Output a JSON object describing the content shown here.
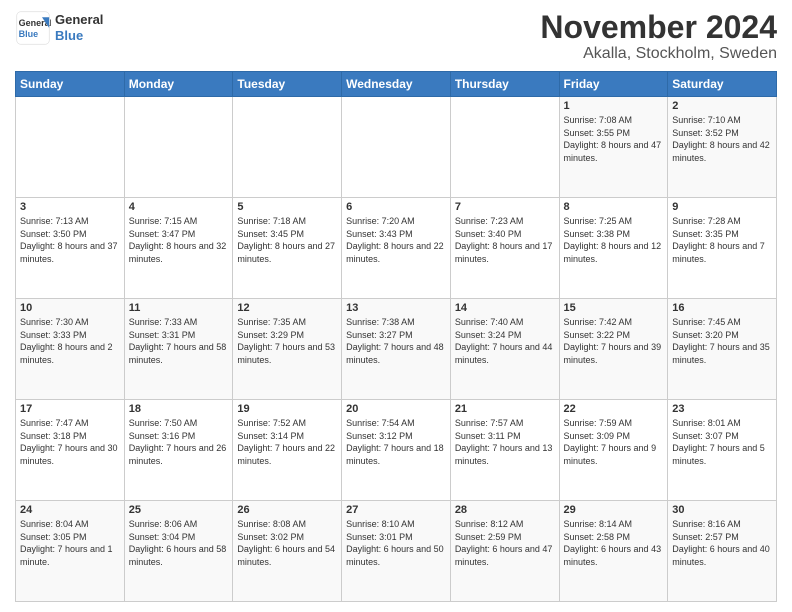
{
  "logo": {
    "line1": "General",
    "line2": "Blue"
  },
  "title": "November 2024",
  "location": "Akalla, Stockholm, Sweden",
  "days_of_week": [
    "Sunday",
    "Monday",
    "Tuesday",
    "Wednesday",
    "Thursday",
    "Friday",
    "Saturday"
  ],
  "weeks": [
    [
      {
        "day": "",
        "info": ""
      },
      {
        "day": "",
        "info": ""
      },
      {
        "day": "",
        "info": ""
      },
      {
        "day": "",
        "info": ""
      },
      {
        "day": "",
        "info": ""
      },
      {
        "day": "1",
        "info": "Sunrise: 7:08 AM\nSunset: 3:55 PM\nDaylight: 8 hours and 47 minutes."
      },
      {
        "day": "2",
        "info": "Sunrise: 7:10 AM\nSunset: 3:52 PM\nDaylight: 8 hours and 42 minutes."
      }
    ],
    [
      {
        "day": "3",
        "info": "Sunrise: 7:13 AM\nSunset: 3:50 PM\nDaylight: 8 hours and 37 minutes."
      },
      {
        "day": "4",
        "info": "Sunrise: 7:15 AM\nSunset: 3:47 PM\nDaylight: 8 hours and 32 minutes."
      },
      {
        "day": "5",
        "info": "Sunrise: 7:18 AM\nSunset: 3:45 PM\nDaylight: 8 hours and 27 minutes."
      },
      {
        "day": "6",
        "info": "Sunrise: 7:20 AM\nSunset: 3:43 PM\nDaylight: 8 hours and 22 minutes."
      },
      {
        "day": "7",
        "info": "Sunrise: 7:23 AM\nSunset: 3:40 PM\nDaylight: 8 hours and 17 minutes."
      },
      {
        "day": "8",
        "info": "Sunrise: 7:25 AM\nSunset: 3:38 PM\nDaylight: 8 hours and 12 minutes."
      },
      {
        "day": "9",
        "info": "Sunrise: 7:28 AM\nSunset: 3:35 PM\nDaylight: 8 hours and 7 minutes."
      }
    ],
    [
      {
        "day": "10",
        "info": "Sunrise: 7:30 AM\nSunset: 3:33 PM\nDaylight: 8 hours and 2 minutes."
      },
      {
        "day": "11",
        "info": "Sunrise: 7:33 AM\nSunset: 3:31 PM\nDaylight: 7 hours and 58 minutes."
      },
      {
        "day": "12",
        "info": "Sunrise: 7:35 AM\nSunset: 3:29 PM\nDaylight: 7 hours and 53 minutes."
      },
      {
        "day": "13",
        "info": "Sunrise: 7:38 AM\nSunset: 3:27 PM\nDaylight: 7 hours and 48 minutes."
      },
      {
        "day": "14",
        "info": "Sunrise: 7:40 AM\nSunset: 3:24 PM\nDaylight: 7 hours and 44 minutes."
      },
      {
        "day": "15",
        "info": "Sunrise: 7:42 AM\nSunset: 3:22 PM\nDaylight: 7 hours and 39 minutes."
      },
      {
        "day": "16",
        "info": "Sunrise: 7:45 AM\nSunset: 3:20 PM\nDaylight: 7 hours and 35 minutes."
      }
    ],
    [
      {
        "day": "17",
        "info": "Sunrise: 7:47 AM\nSunset: 3:18 PM\nDaylight: 7 hours and 30 minutes."
      },
      {
        "day": "18",
        "info": "Sunrise: 7:50 AM\nSunset: 3:16 PM\nDaylight: 7 hours and 26 minutes."
      },
      {
        "day": "19",
        "info": "Sunrise: 7:52 AM\nSunset: 3:14 PM\nDaylight: 7 hours and 22 minutes."
      },
      {
        "day": "20",
        "info": "Sunrise: 7:54 AM\nSunset: 3:12 PM\nDaylight: 7 hours and 18 minutes."
      },
      {
        "day": "21",
        "info": "Sunrise: 7:57 AM\nSunset: 3:11 PM\nDaylight: 7 hours and 13 minutes."
      },
      {
        "day": "22",
        "info": "Sunrise: 7:59 AM\nSunset: 3:09 PM\nDaylight: 7 hours and 9 minutes."
      },
      {
        "day": "23",
        "info": "Sunrise: 8:01 AM\nSunset: 3:07 PM\nDaylight: 7 hours and 5 minutes."
      }
    ],
    [
      {
        "day": "24",
        "info": "Sunrise: 8:04 AM\nSunset: 3:05 PM\nDaylight: 7 hours and 1 minute."
      },
      {
        "day": "25",
        "info": "Sunrise: 8:06 AM\nSunset: 3:04 PM\nDaylight: 6 hours and 58 minutes."
      },
      {
        "day": "26",
        "info": "Sunrise: 8:08 AM\nSunset: 3:02 PM\nDaylight: 6 hours and 54 minutes."
      },
      {
        "day": "27",
        "info": "Sunrise: 8:10 AM\nSunset: 3:01 PM\nDaylight: 6 hours and 50 minutes."
      },
      {
        "day": "28",
        "info": "Sunrise: 8:12 AM\nSunset: 2:59 PM\nDaylight: 6 hours and 47 minutes."
      },
      {
        "day": "29",
        "info": "Sunrise: 8:14 AM\nSunset: 2:58 PM\nDaylight: 6 hours and 43 minutes."
      },
      {
        "day": "30",
        "info": "Sunrise: 8:16 AM\nSunset: 2:57 PM\nDaylight: 6 hours and 40 minutes."
      }
    ]
  ]
}
